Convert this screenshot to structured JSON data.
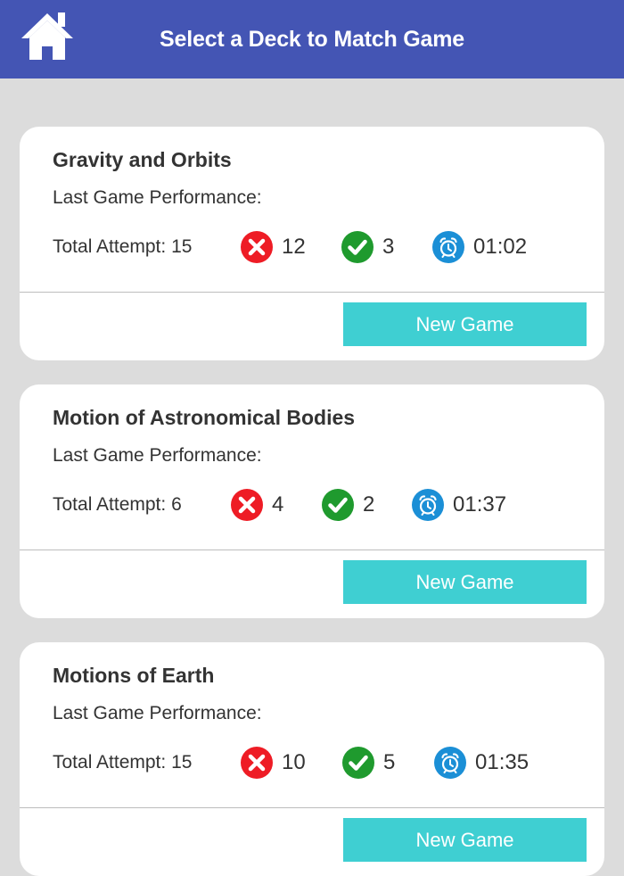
{
  "header": {
    "title": "Select a Deck to Match Game",
    "home_icon": "home-icon",
    "background_color": "#4455b4"
  },
  "decks": [
    {
      "title": "Gravity and Orbits",
      "subtitle": "Last Game Performance:",
      "attempt_label": "Total Attempt: 15",
      "wrong": "12",
      "correct": "3",
      "time": "01:02",
      "button_label": "New Game"
    },
    {
      "title": "Motion of Astronomical Bodies",
      "subtitle": "Last Game Performance:",
      "attempt_label": "Total Attempt: 6",
      "wrong": "4",
      "correct": "2",
      "time": "01:37",
      "button_label": "New Game"
    },
    {
      "title": "Motions of Earth",
      "subtitle": "Last Game Performance:",
      "attempt_label": "Total Attempt: 15",
      "wrong": "10",
      "correct": "5",
      "time": "01:35",
      "button_label": "New Game"
    }
  ],
  "icons": {
    "wrong": "x-circle-icon",
    "correct": "check-circle-icon",
    "time": "alarm-clock-icon"
  },
  "colors": {
    "wrong": "#ee1c25",
    "correct": "#1f9a2e",
    "time": "#1b8fd6",
    "button": "#3fcfd2",
    "page_background": "#dcdcdc"
  }
}
